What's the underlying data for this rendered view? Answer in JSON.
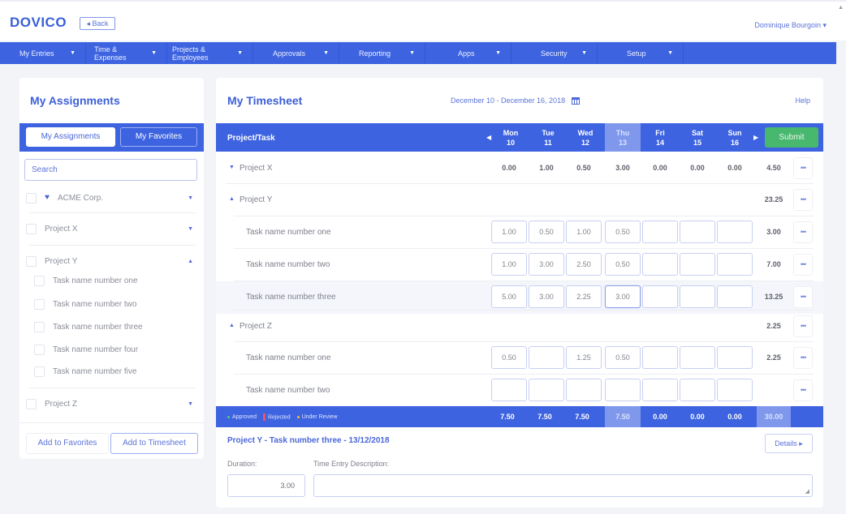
{
  "app": {
    "logo": "DOVICO",
    "back_label": "◂ Back",
    "user_name": "Dominique Bourgoin ▾"
  },
  "nav": [
    {
      "label": "My Entries"
    },
    {
      "label": "Time & Expenses"
    },
    {
      "label": "Projects & Employees"
    },
    {
      "label": "Approvals"
    },
    {
      "label": "Reporting"
    },
    {
      "label": "Apps"
    },
    {
      "label": "Security"
    },
    {
      "label": "Setup"
    }
  ],
  "assignments": {
    "title": "My Assignments",
    "tabs": [
      {
        "label": "My Assignments",
        "active": true
      },
      {
        "label": "My Favorites",
        "active": false
      }
    ],
    "search_placeholder": "Search",
    "items": [
      {
        "label": "ACME Corp.",
        "type": "client",
        "expanded": false
      },
      {
        "label": "Project X",
        "type": "project",
        "expanded": false
      },
      {
        "label": "Project Y",
        "type": "project",
        "expanded": true
      },
      {
        "label": "Task name number one",
        "type": "task"
      },
      {
        "label": "Task name number two",
        "type": "task"
      },
      {
        "label": "Task name number three",
        "type": "task"
      },
      {
        "label": "Task name number four",
        "type": "task"
      },
      {
        "label": "Task name number five",
        "type": "task"
      },
      {
        "label": "Project Z",
        "type": "project",
        "expanded": false
      }
    ],
    "add_favorites_label": "Add to Favorites",
    "add_timesheet_label": "Add to Timesheet"
  },
  "timesheet": {
    "title": "My Timesheet",
    "date_range": "December 10 - December 16, 2018",
    "help_label": "Help",
    "column_project": "Project/Task",
    "days": [
      {
        "name": "Mon",
        "num": "10"
      },
      {
        "name": "Tue",
        "num": "11"
      },
      {
        "name": "Wed",
        "num": "12"
      },
      {
        "name": "Thu",
        "num": "13",
        "highlighted": true
      },
      {
        "name": "Fri",
        "num": "14"
      },
      {
        "name": "Sat",
        "num": "15"
      },
      {
        "name": "Sun",
        "num": "16"
      }
    ],
    "submit_label": "Submit",
    "more_label": "•••",
    "rows": [
      {
        "type": "project",
        "label": "Project X",
        "expanded": false,
        "values": [
          "0.00",
          "1.00",
          "0.50",
          "3.00",
          "0.00",
          "0.00",
          "0.00"
        ],
        "total": "4.50"
      },
      {
        "type": "project",
        "label": "Project Y",
        "expanded": true,
        "values": [],
        "total": "23.25"
      },
      {
        "type": "task",
        "label": "Task name number one",
        "values": [
          "1.00",
          "0.50",
          "1.00",
          "0.50",
          "",
          "",
          ""
        ],
        "total": "3.00"
      },
      {
        "type": "task",
        "label": "Task name number two",
        "values": [
          "1.00",
          "3.00",
          "2.50",
          "0.50",
          "",
          "",
          ""
        ],
        "total": "7.00"
      },
      {
        "type": "task",
        "label": "Task name number three",
        "selected": true,
        "values": [
          "5.00",
          "3.00",
          "2.25",
          "3.00",
          "",
          "",
          ""
        ],
        "total": "13.25"
      },
      {
        "type": "project",
        "label": "Project Z",
        "expanded": true,
        "values": [],
        "total": "2.25"
      },
      {
        "type": "task",
        "label": "Task name number one",
        "values": [
          "0.50",
          "",
          "1.25",
          "0.50",
          "",
          "",
          ""
        ],
        "total": "2.25"
      },
      {
        "type": "task",
        "label": "Task name number two",
        "values": [
          "",
          "",
          "",
          "",
          "",
          "",
          ""
        ],
        "total": ""
      }
    ],
    "legend": [
      {
        "label": "Approved",
        "color": "#4cd06a"
      },
      {
        "label": "Rejected",
        "color": "#e8556a"
      },
      {
        "label": "Under Review",
        "color": "#f5b93c"
      }
    ],
    "daily_totals": [
      "7.50",
      "7.50",
      "7.50",
      "7.50",
      "0.00",
      "0.00",
      "0.00"
    ],
    "grand_total": "30.00"
  },
  "entry_detail": {
    "title": "Project Y - Task number three - 13/12/2018",
    "details_label": "Details ▸",
    "duration_label": "Duration:",
    "duration_value": "3.00",
    "description_label": "Time Entry Description:",
    "description_value": ""
  }
}
